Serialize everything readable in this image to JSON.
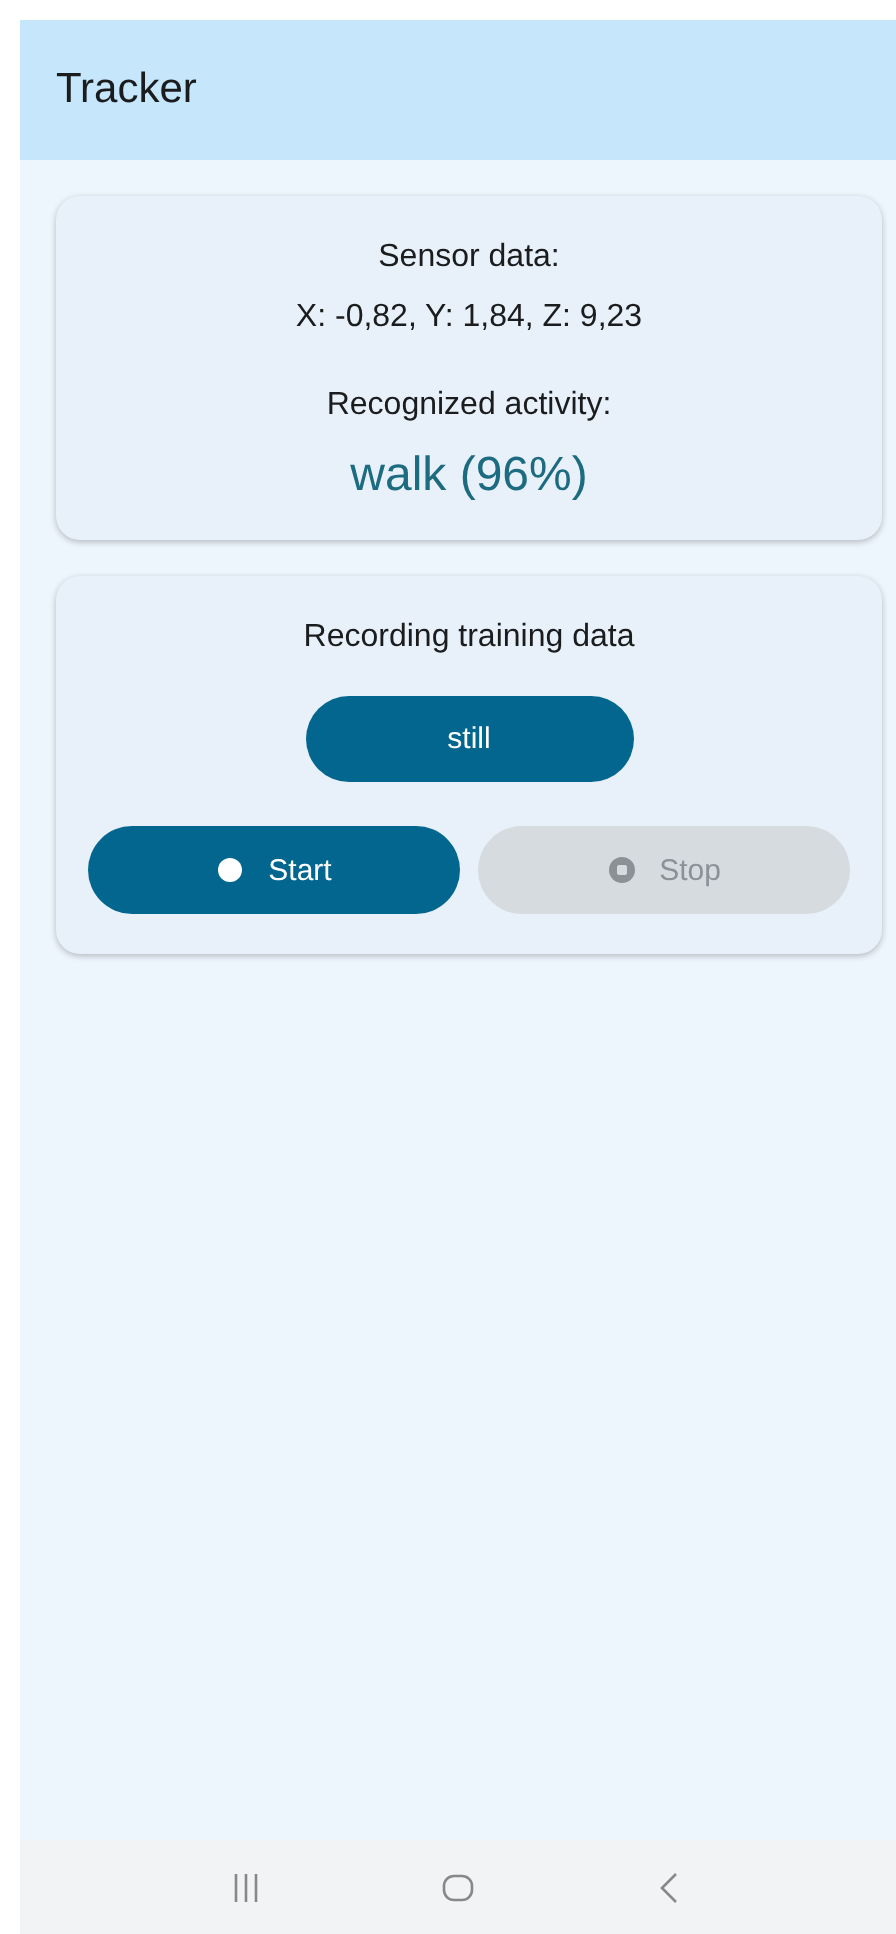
{
  "app_bar": {
    "title": "Tracker"
  },
  "sensor_card": {
    "title": "Sensor data:",
    "reading": "X: -0,82, Y: 1,84, Z: 9,23",
    "activity_label": "Recognized activity:",
    "activity": "walk (96%)"
  },
  "recording_card": {
    "title": "Recording training data",
    "label_button": "still",
    "buttons": [
      {
        "kind": "start",
        "label": "Start",
        "disabled": false
      },
      {
        "kind": "stop",
        "label": "Stop",
        "disabled": true
      }
    ]
  }
}
